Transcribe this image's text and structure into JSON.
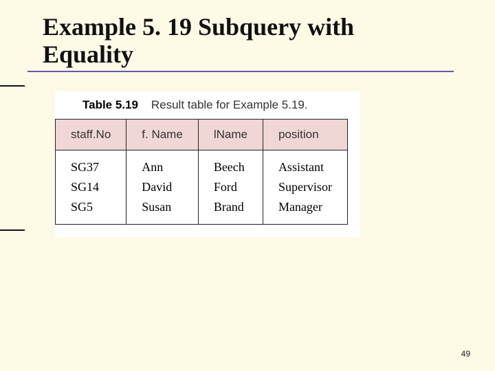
{
  "title_line1": "Example 5. 19  Subquery with",
  "title_line2": "Equality",
  "caption_bold": "Table 5.19",
  "caption_rest": "Result table for Example 5.19.",
  "columns": [
    "staff.No",
    "f. Name",
    "lName",
    "position"
  ],
  "rows": [
    {
      "staffNo": "SG37",
      "fName": "Ann",
      "lName": "Beech",
      "position": "Assistant"
    },
    {
      "staffNo": "SG14",
      "fName": "David",
      "lName": "Ford",
      "position": "Supervisor"
    },
    {
      "staffNo": "SG5",
      "fName": "Susan",
      "lName": "Brand",
      "position": "Manager"
    }
  ],
  "page_number": "49"
}
